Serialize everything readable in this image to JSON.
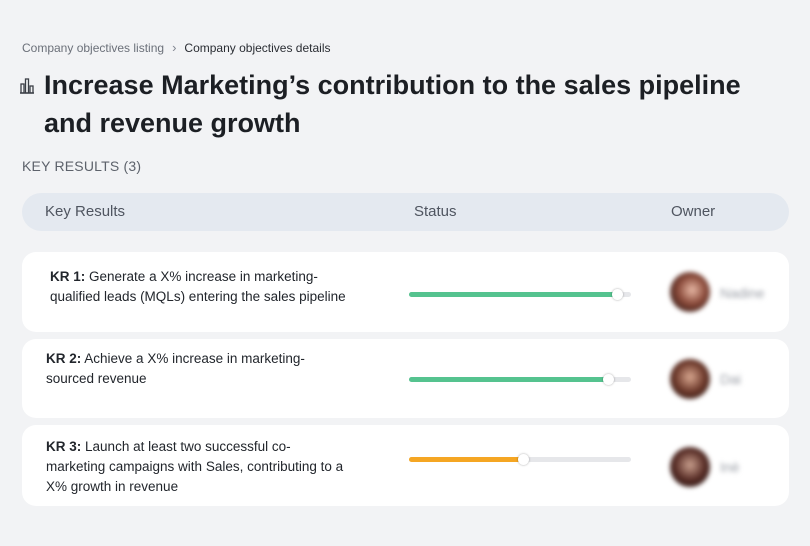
{
  "breadcrumb": {
    "items": [
      "Company objectives listing",
      "Company objectives details"
    ],
    "separator": "›"
  },
  "page": {
    "title": "Increase Marketing’s contribution to the sales pipeline and revenue growth",
    "title_icon": "building-chart-icon"
  },
  "section": {
    "label": "KEY RESULTS (3)"
  },
  "table": {
    "columns": [
      "Key Results",
      "Status",
      "Owner"
    ]
  },
  "key_results": [
    {
      "label": "KR 1:",
      "text": "Generate a X% increase in marketing-qualified leads (MQLs) entering the sales pipeline",
      "progress_pct": 94,
      "bar_color": "#55c38f",
      "owner": "Nadine"
    },
    {
      "label": "KR 2:",
      "text": "Achieve a X% increase in marketing-sourced revenue",
      "progress_pct": 90,
      "bar_color": "#55c38f",
      "owner": "Dai"
    },
    {
      "label": "KR 3:",
      "text": "Launch at least two successful co-marketing campaigns with Sales, contributing to a X% growth in revenue",
      "progress_pct": 52,
      "bar_color": "#f5a623",
      "owner": "Inè"
    }
  ]
}
